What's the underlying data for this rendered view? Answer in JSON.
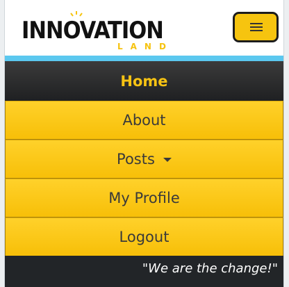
{
  "header": {
    "logo_text": "INNOVATION",
    "logo_subtext": "LAND",
    "menu_button_label": "≡"
  },
  "nav": {
    "items": [
      {
        "label": "Home"
      },
      {
        "label": "About"
      },
      {
        "label": "Posts"
      },
      {
        "label": "My Profile"
      },
      {
        "label": "Logout"
      }
    ]
  },
  "footer": {
    "tagline": "\"We are the change!\""
  },
  "colors": {
    "brand_yellow": "#f6c40f",
    "accent_blue": "#5bc8ef",
    "dark": "#222528"
  },
  "icons": {
    "menu": "hamburger-icon",
    "dropdown": "caret-down-icon",
    "logo_bulb": "lightbulb-icon"
  }
}
